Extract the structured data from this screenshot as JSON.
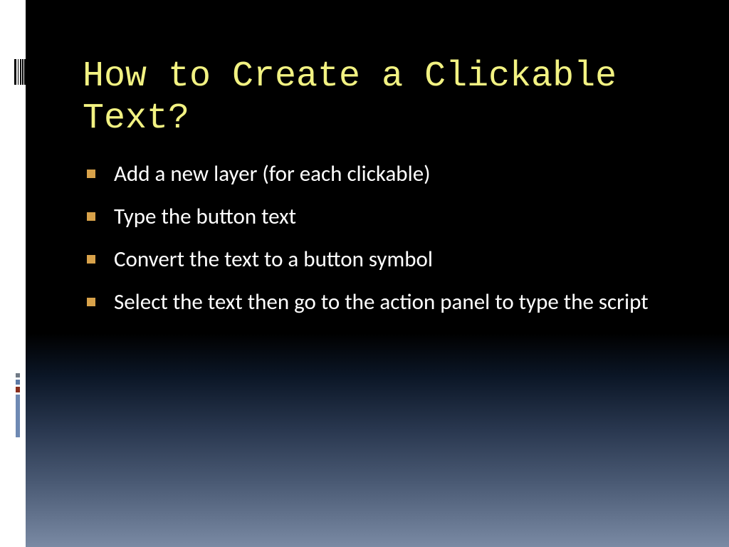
{
  "slide": {
    "title": "How to Create a Clickable Text?",
    "bullets": [
      "Add a new layer (for each clickable)",
      "Type the button text",
      "Convert the text to a button symbol",
      "Select the text then go to the action panel to type the script"
    ]
  }
}
